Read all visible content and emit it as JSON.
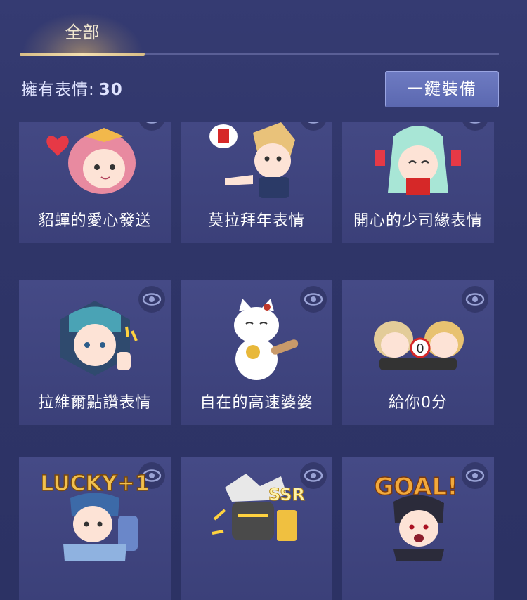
{
  "tabs": [
    {
      "label": "全部",
      "active": true
    }
  ],
  "owned": {
    "label": "擁有表情:",
    "count": "30"
  },
  "equip_button": "一鍵裝備",
  "emotes": [
    {
      "name": "貂蟬的愛心發送",
      "icon": "heart-emote-icon"
    },
    {
      "name": "莫拉拜年表情",
      "icon": "new-year-emote-icon"
    },
    {
      "name": "開心的少司緣表情",
      "icon": "happy-emote-icon"
    },
    {
      "name": "拉維爾點讚表情",
      "icon": "thumbs-up-emote-icon"
    },
    {
      "name": "自在的高速婆婆",
      "icon": "lucky-cat-emote-icon"
    },
    {
      "name": "給你0分",
      "icon": "zero-score-emote-icon"
    },
    {
      "name": "",
      "icon": "lucky-plus-one-emote-icon",
      "art_text": "LUCKY+1"
    },
    {
      "name": "",
      "icon": "ssr-emote-icon",
      "art_text": "SSR"
    },
    {
      "name": "",
      "icon": "goal-emote-icon",
      "art_text": "GOAL!"
    }
  ],
  "colors": {
    "accent_gold": "#e6c88f",
    "background": "#323869",
    "card": "#42478a",
    "button": "#6573ba"
  }
}
